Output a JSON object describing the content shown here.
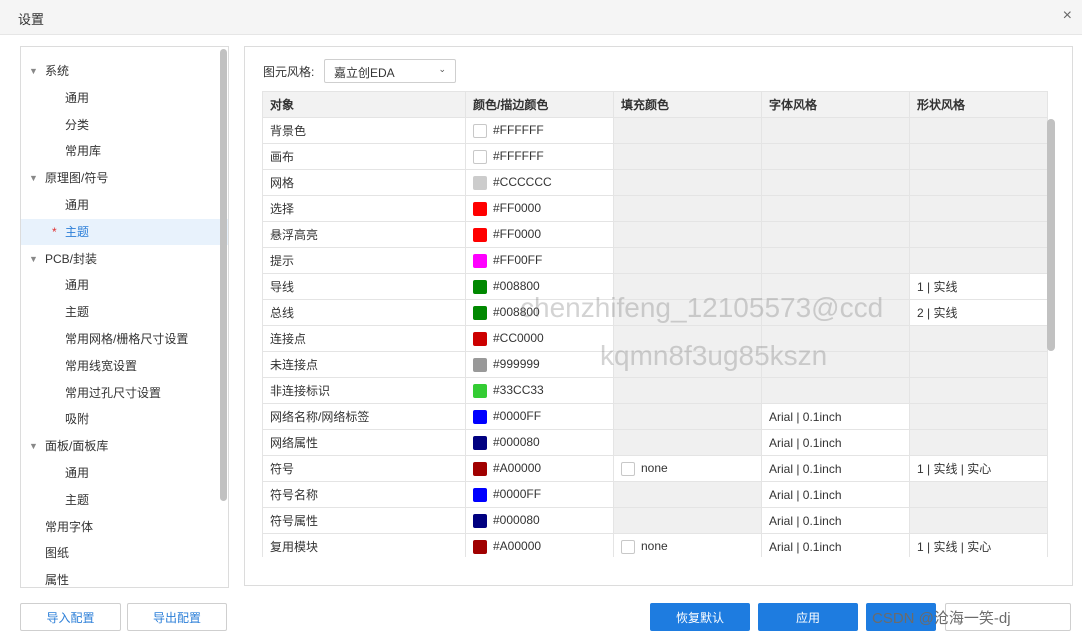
{
  "window": {
    "title": "设置",
    "close_glyph": "×"
  },
  "tree": [
    {
      "label": "系统",
      "level": 0,
      "expanded": true
    },
    {
      "label": "通用",
      "level": 1
    },
    {
      "label": "分类",
      "level": 1
    },
    {
      "label": "常用库",
      "level": 1
    },
    {
      "label": "原理图/符号",
      "level": 0,
      "expanded": true
    },
    {
      "label": "通用",
      "level": 1
    },
    {
      "label": "主题",
      "level": 1,
      "selected": true,
      "marker": "*"
    },
    {
      "label": "PCB/封装",
      "level": 0,
      "expanded": true
    },
    {
      "label": "通用",
      "level": 1
    },
    {
      "label": "主题",
      "level": 1
    },
    {
      "label": "常用网格/栅格尺寸设置",
      "level": 1
    },
    {
      "label": "常用线宽设置",
      "level": 1
    },
    {
      "label": "常用过孔尺寸设置",
      "level": 1
    },
    {
      "label": "吸附",
      "level": 1
    },
    {
      "label": "面板/面板库",
      "level": 0,
      "expanded": true
    },
    {
      "label": "通用",
      "level": 1
    },
    {
      "label": "主题",
      "level": 1
    },
    {
      "label": "常用字体",
      "level": 0,
      "root": true
    },
    {
      "label": "图纸",
      "level": 0,
      "root": true
    },
    {
      "label": "属性",
      "level": 0,
      "root": true
    }
  ],
  "style": {
    "label": "图元风格:",
    "selected": "嘉立创EDA"
  },
  "table": {
    "headers": [
      "对象",
      "颜色/描边颜色",
      "填充颜色",
      "字体风格",
      "形状风格"
    ],
    "rows": [
      {
        "obj": "背景色",
        "color": "#FFFFFF",
        "swatch": "#FFFFFF",
        "fill": "",
        "font": "",
        "shape": ""
      },
      {
        "obj": "画布",
        "color": "#FFFFFF",
        "swatch": "#FFFFFF",
        "fill": "",
        "font": "",
        "shape": ""
      },
      {
        "obj": "网格",
        "color": "#CCCCCC",
        "swatch": "#CCCCCC",
        "fill": "",
        "font": "",
        "shape": ""
      },
      {
        "obj": "选择",
        "color": "#FF0000",
        "swatch": "#FF0000",
        "fill": "",
        "font": "",
        "shape": ""
      },
      {
        "obj": "悬浮高亮",
        "color": "#FF0000",
        "swatch": "#FF0000",
        "fill": "",
        "font": "",
        "shape": ""
      },
      {
        "obj": "提示",
        "color": "#FF00FF",
        "swatch": "#FF00FF",
        "fill": "",
        "font": "",
        "shape": ""
      },
      {
        "obj": "导线",
        "color": "#008800",
        "swatch": "#008800",
        "fill": "",
        "font": "",
        "shape": "1 | 实线"
      },
      {
        "obj": "总线",
        "color": "#008800",
        "swatch": "#008800",
        "fill": "",
        "font": "",
        "shape": "2 | 实线"
      },
      {
        "obj": "连接点",
        "color": "#CC0000",
        "swatch": "#CC0000",
        "fill": "",
        "font": "",
        "shape": ""
      },
      {
        "obj": "未连接点",
        "color": "#999999",
        "swatch": "#999999",
        "fill": "",
        "font": "",
        "shape": ""
      },
      {
        "obj": "非连接标识",
        "color": "#33CC33",
        "swatch": "#33CC33",
        "fill": "",
        "font": "",
        "shape": ""
      },
      {
        "obj": "网络名称/网络标签",
        "color": "#0000FF",
        "swatch": "#0000FF",
        "fill": "",
        "font": "Arial | 0.1inch",
        "shape": ""
      },
      {
        "obj": "网络属性",
        "color": "#000080",
        "swatch": "#000080",
        "fill": "",
        "font": "Arial | 0.1inch",
        "shape": ""
      },
      {
        "obj": "符号",
        "color": "#A00000",
        "swatch": "#A00000",
        "fill": "none",
        "font": "Arial | 0.1inch",
        "shape": "1 | 实线 | 实心"
      },
      {
        "obj": "符号名称",
        "color": "#0000FF",
        "swatch": "#0000FF",
        "fill": "",
        "font": "Arial | 0.1inch",
        "shape": ""
      },
      {
        "obj": "符号属性",
        "color": "#000080",
        "swatch": "#000080",
        "fill": "",
        "font": "Arial | 0.1inch",
        "shape": ""
      },
      {
        "obj": "复用模块",
        "color": "#A00000",
        "swatch": "#A00000",
        "fill": "none",
        "font": "Arial | 0.1inch",
        "shape": "1 | 实线 | 实心"
      }
    ]
  },
  "watermark": {
    "line1": "chenzhifeng_12105573@ccd",
    "line2": "kqmn8f3ug85kszn"
  },
  "buttons": {
    "import": "导入配置",
    "export": "导出配置",
    "restore": "恢复默认",
    "apply": "应用",
    "cancel": "取消"
  },
  "csdn_watermark": "CSDN @沧海一笑-dj",
  "colors": {
    "primary": "#1e7ce0",
    "selected_bg": "#e8f2fc",
    "link": "#2c7fd8"
  }
}
